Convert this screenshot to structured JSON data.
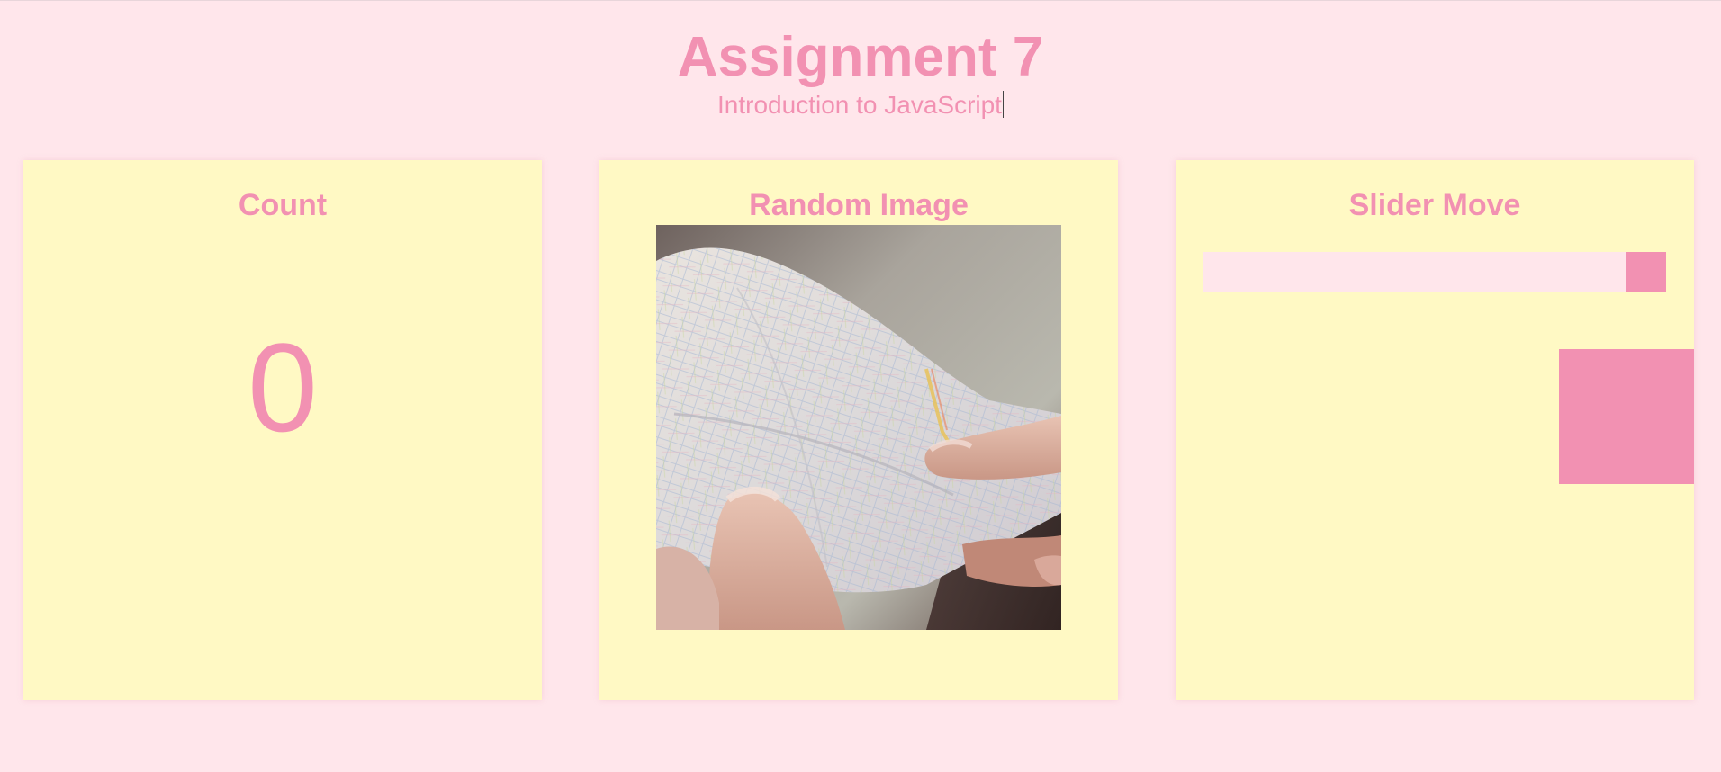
{
  "header": {
    "title": "Assignment 7",
    "subtitle": "Introduction to JavaScript"
  },
  "count_card": {
    "title": "Count",
    "value": "0"
  },
  "image_card": {
    "title": "Random Image",
    "image_alt": "hands holding a folded map"
  },
  "slider_card": {
    "title": "Slider Move",
    "slider_value": 1.0,
    "box_position": 1.0
  },
  "colors": {
    "background": "#ffe6eb",
    "card": "#fff9c4",
    "accent": "#f291b2"
  }
}
